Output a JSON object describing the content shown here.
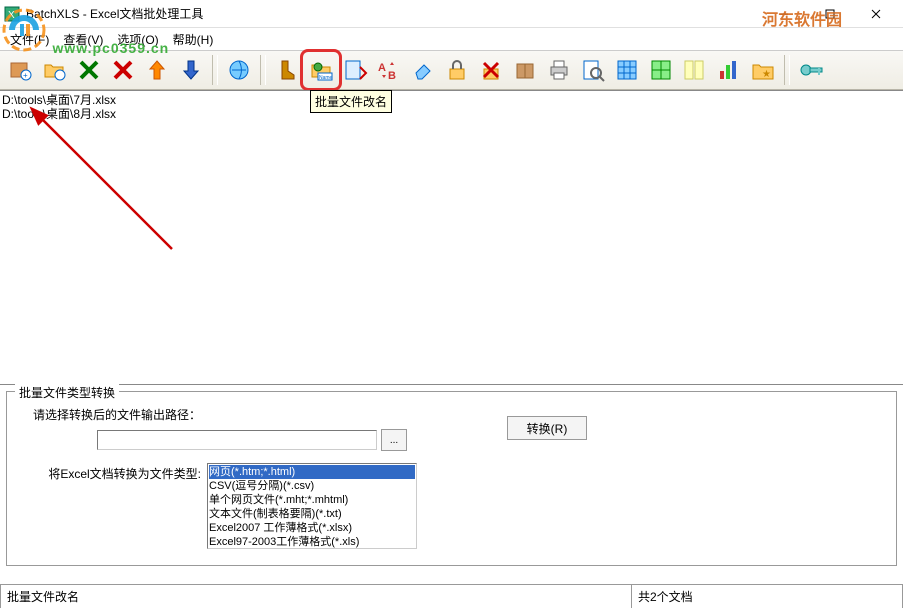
{
  "window": {
    "title": "BatchXLS - Excel文档批处理工具"
  },
  "menu": {
    "file": "文件(F)",
    "view": "查看(V)",
    "options": "选项(O)",
    "help": "帮助(H)"
  },
  "watermark": {
    "url": "www.pc0359.cn",
    "site": "河东软件园"
  },
  "toolbar": {
    "tooltip_rename": "批量文件改名"
  },
  "files": {
    "items": [
      "D:\\tools\\桌面\\7月.xlsx",
      "D:\\tools\\桌面\\8月.xlsx"
    ]
  },
  "convert_panel": {
    "legend": "批量文件类型转换",
    "path_label": "请选择转换后的文件输出路径：",
    "path_value": "",
    "browse": "...",
    "convert_btn": "转换(R)",
    "type_label": "将Excel文档转换为文件类型:",
    "types": [
      "网页(*.htm;*.html)",
      "CSV(逗号分隔)(*.csv)",
      "单个网页文件(*.mht;*.mhtml)",
      "文本文件(制表格要隔)(*.txt)",
      "Excel2007 工作薄格式(*.xlsx)",
      "Excel97-2003工作薄格式(*.xls)"
    ]
  },
  "status": {
    "left": "批量文件改名",
    "right": "共2个文档"
  }
}
